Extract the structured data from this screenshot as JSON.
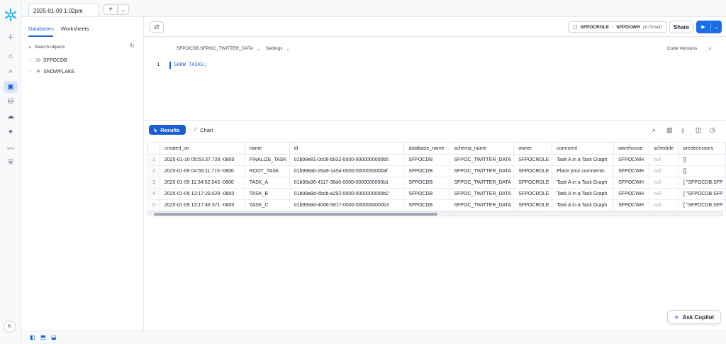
{
  "colors": {
    "accent": "#1a5fd0",
    "run": "#1a6fe8",
    "logo": "#29b5e8"
  },
  "topbar": {
    "worksheet_tab": "2025-01-09 1:02pm"
  },
  "leftpanel": {
    "tabs": [
      "Databases",
      "Worksheets"
    ],
    "search_placeholder": "Search objects",
    "tree": [
      {
        "label": "SFPOCDB",
        "icon": "database-icon"
      },
      {
        "label": "SNOWFLAKE",
        "icon": "shared-database-icon"
      }
    ]
  },
  "editor": {
    "role": "SFPOCROLE",
    "warehouse": "SFPOCWH",
    "warehouse_size": "(X-Small)",
    "share_label": "Share",
    "context": "SFPOCDB.SFPOC_TWITTER_DATA",
    "settings_label": "Settings",
    "code_versions_label": "Code Versions",
    "line_number": "1",
    "code": "SHOW TASKS;"
  },
  "results": {
    "results_tab": "Results",
    "chart_tab": "Chart",
    "columns": [
      "created_on",
      "name",
      "id",
      "database_name",
      "schema_name",
      "owner",
      "comment",
      "warehouse",
      "schedule",
      "predecessors"
    ],
    "rows": [
      [
        "1",
        "2025-01-10 05:53:37.728 -0800",
        "FINALIZE_TASK",
        "01b99e81-0c08-b932-0000-0000000000b5",
        "SFPOCDB",
        "SFPOC_TWITTER_DATA",
        "SFPOCROLE",
        "Task A in a Task Graph",
        "SFPOCWH",
        "null",
        "[]"
      ],
      [
        "2",
        "2025-01-09 04:59:11.715 -0800",
        "ROOT_TASK",
        "01b998ab-26a9-1454-0000-0000000000af",
        "SFPOCDB",
        "SFPOC_TWITTER_DATA",
        "SFPOCROLE",
        "Place your comments",
        "SFPOCWH",
        "null",
        "[]"
      ],
      [
        "3",
        "2025-01-09 11:34:52.543 -0800",
        "TASK_A",
        "01b99a36-4117-36d0-0000-0000000000b1",
        "SFPOCDB",
        "SFPOC_TWITTER_DATA",
        "SFPOCROLE",
        "Task A in a Task Graph",
        "SFPOCWH",
        "null",
        "[  \"SFPOCDB.SFP"
      ],
      [
        "4",
        "2025-01-09 13:17:29.629 -0800",
        "TASK_B",
        "01b99a9d-6bcb-a292-0000-0000000000b2",
        "SFPOCDB",
        "SFPOC_TWITTER_DATA",
        "SFPOCROLE",
        "Task A in a Task Graph",
        "SFPOCWH",
        "null",
        "[  \"SFPOCDB.SFP"
      ],
      [
        "5",
        "2025-01-09 13:17:48.371 -0800",
        "TASK_C",
        "01b99a9d-4066-5817-0000-0000000000b3",
        "SFPOCDB",
        "SFPOC_TWITTER_DATA",
        "SFPOCROLE",
        "Task A in a Task Graph",
        "SFPOCWH",
        "null",
        "[  \"SFPOCDB.SFP"
      ]
    ]
  },
  "copilot_label": "Ask Copilot",
  "avatar_initial": "K"
}
